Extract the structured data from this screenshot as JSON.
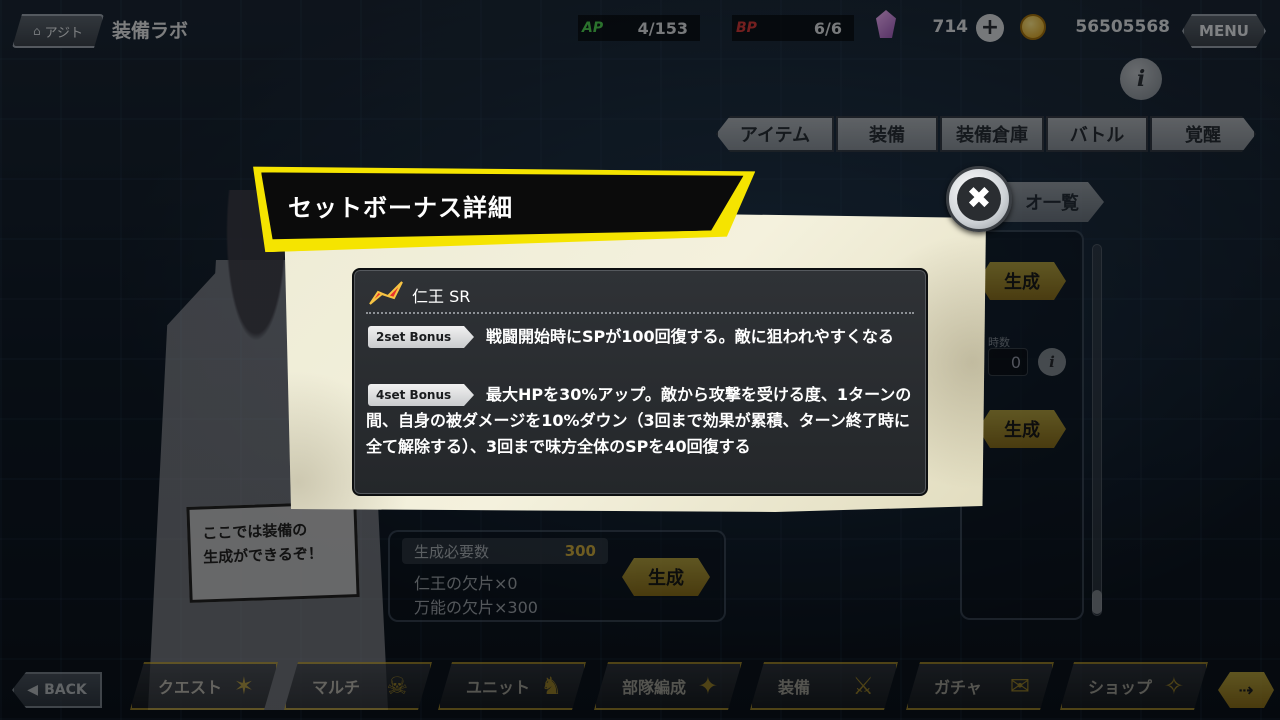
{
  "header": {
    "home_label": "アジト",
    "screen_title": "装備ラボ",
    "ap_label": "AP",
    "ap_value": "4/153",
    "bp_label": "BP",
    "bp_value": "6/6",
    "gem_value": "714",
    "coin_value": "56505568",
    "menu_label": "MENU",
    "info_label": "i"
  },
  "tabs": [
    {
      "label": "アイテム",
      "width": 118
    },
    {
      "label": "装備",
      "width": 102
    },
    {
      "label": "装備倉庫",
      "width": 104
    },
    {
      "label": "バトル",
      "width": 102
    },
    {
      "label": "覚醒",
      "width": 106
    }
  ],
  "background_ui": {
    "list_label": "オ一覧",
    "generate_label": "生成",
    "count_label": "時数",
    "count_value": "0",
    "speech_bubble": "ここでは装備の\n生成ができるぞ！",
    "requirement_label": "生成必要数",
    "requirement_value": "300",
    "fragment_1": "仁王の欠片×0",
    "fragment_2": "万能の欠片×300"
  },
  "modal": {
    "title": "セットボーナス詳細",
    "close_symbol": "✖",
    "equipment_name": "仁王 SR",
    "bonuses": [
      {
        "tag": "2set Bonus",
        "text": "戦闘開始時にSPが100回復する。敵に狙われやすくなる"
      },
      {
        "tag": "4set Bonus",
        "text": "最大HPを30%アップ。敵から攻撃を受ける度、1ターンの間、自身の被ダメージを10%ダウン（3回まで効果が累積、ターン終了時に全て解除する）、3回まで味方全体のSPを40回復する"
      }
    ]
  },
  "bottom_nav": {
    "back_label": "BACK",
    "items": [
      "クエスト",
      "マルチ",
      "ユニット",
      "部隊編成",
      "装備",
      "ガチャ",
      "ショップ"
    ],
    "next_symbol": "⇢"
  },
  "colors": {
    "accent_yellow": "#f5e400",
    "ap_green": "#4fcf52",
    "bp_red": "#d23a3a",
    "panel_dark": "#2f3236",
    "card_cream": "#eeecd6"
  }
}
